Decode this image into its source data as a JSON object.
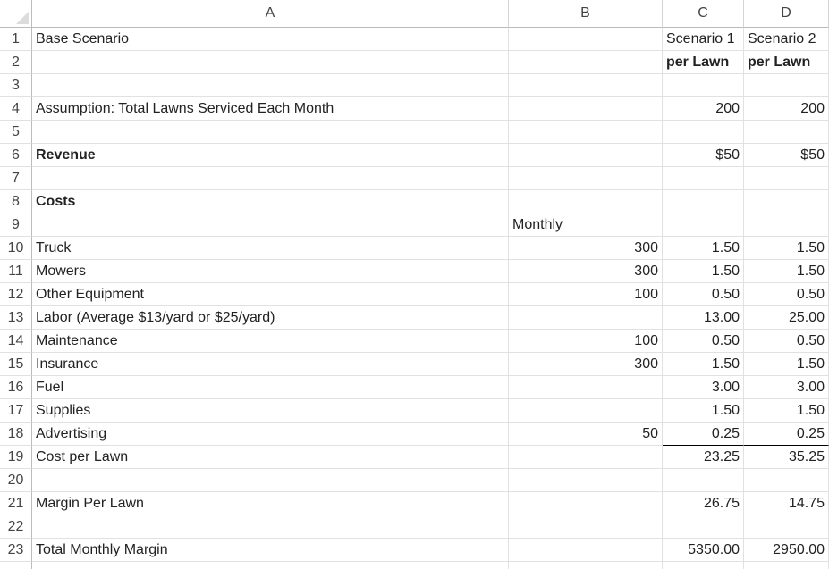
{
  "columns": [
    "",
    "A",
    "B",
    "C",
    "D"
  ],
  "rows": [
    {
      "n": "1",
      "a": "Base Scenario",
      "b": "",
      "c": "Scenario 1",
      "d": "Scenario 2"
    },
    {
      "n": "2",
      "a": "",
      "b": "",
      "c": "per Lawn",
      "d": "per Lawn"
    },
    {
      "n": "3",
      "a": "",
      "b": "",
      "c": "",
      "d": ""
    },
    {
      "n": "4",
      "a": "Assumption: Total Lawns Serviced Each Month",
      "b": "",
      "c": "200",
      "d": "200"
    },
    {
      "n": "5",
      "a": "",
      "b": "",
      "c": "",
      "d": ""
    },
    {
      "n": "6",
      "a": "Revenue",
      "b": "",
      "c": "$50",
      "d": "$50"
    },
    {
      "n": "7",
      "a": "",
      "b": "",
      "c": "",
      "d": ""
    },
    {
      "n": "8",
      "a": "Costs",
      "b": "",
      "c": "",
      "d": ""
    },
    {
      "n": "9",
      "a": "",
      "b": "Monthly",
      "c": "",
      "d": ""
    },
    {
      "n": "10",
      "a": "Truck",
      "b": "300",
      "c": "1.50",
      "d": "1.50"
    },
    {
      "n": "11",
      "a": "Mowers",
      "b": "300",
      "c": "1.50",
      "d": "1.50"
    },
    {
      "n": "12",
      "a": "Other Equipment",
      "b": "100",
      "c": "0.50",
      "d": "0.50"
    },
    {
      "n": "13",
      "a": "Labor (Average $13/yard or $25/yard)",
      "b": "",
      "c": "13.00",
      "d": "25.00"
    },
    {
      "n": "14",
      "a": "Maintenance",
      "b": "100",
      "c": "0.50",
      "d": "0.50"
    },
    {
      "n": "15",
      "a": "Insurance",
      "b": "300",
      "c": "1.50",
      "d": "1.50"
    },
    {
      "n": "16",
      "a": "Fuel",
      "b": "",
      "c": "3.00",
      "d": "3.00"
    },
    {
      "n": "17",
      "a": "Supplies",
      "b": "",
      "c": "1.50",
      "d": "1.50"
    },
    {
      "n": "18",
      "a": "Advertising",
      "b": "50",
      "c": "0.25",
      "d": "0.25"
    },
    {
      "n": "19",
      "a": "Cost per Lawn",
      "b": "",
      "c": "23.25",
      "d": "35.25"
    },
    {
      "n": "20",
      "a": "",
      "b": "",
      "c": "",
      "d": ""
    },
    {
      "n": "21",
      "a": "Margin Per Lawn",
      "b": "",
      "c": "26.75",
      "d": "14.75"
    },
    {
      "n": "22",
      "a": "",
      "b": "",
      "c": "",
      "d": ""
    },
    {
      "n": "23",
      "a": "Total Monthly Margin",
      "b": "",
      "c": "5350.00",
      "d": "2950.00"
    }
  ]
}
